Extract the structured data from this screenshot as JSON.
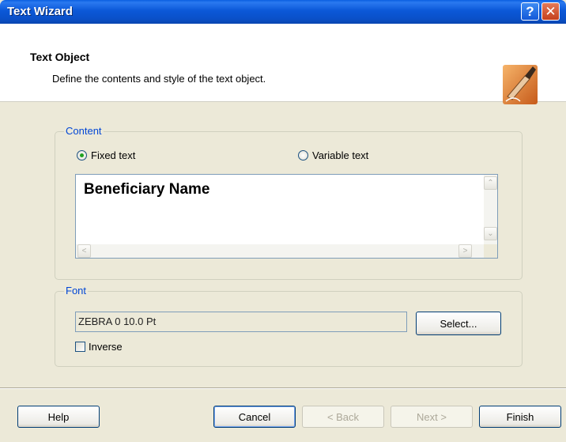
{
  "window": {
    "title": "Text Wizard",
    "help_glyph": "?",
    "close_glyph": "✕"
  },
  "header": {
    "title": "Text Object",
    "description": "Define the contents and style of the text object."
  },
  "content": {
    "legend": "Content",
    "radio_fixed": "Fixed text",
    "radio_variable": "Variable text",
    "selected": "Fixed text",
    "text_value": "Beneficiary Name"
  },
  "font": {
    "legend": "Font",
    "value": "ZEBRA 0 10.0 Pt",
    "select_label": "Select...",
    "inverse_label": "Inverse",
    "inverse_checked": false
  },
  "buttons": {
    "help": "Help",
    "cancel": "Cancel",
    "back": "< Back",
    "next": "Next >",
    "finish": "Finish"
  },
  "scroll": {
    "up": "⌃",
    "down": "⌄",
    "left": "<",
    "right": ">"
  }
}
